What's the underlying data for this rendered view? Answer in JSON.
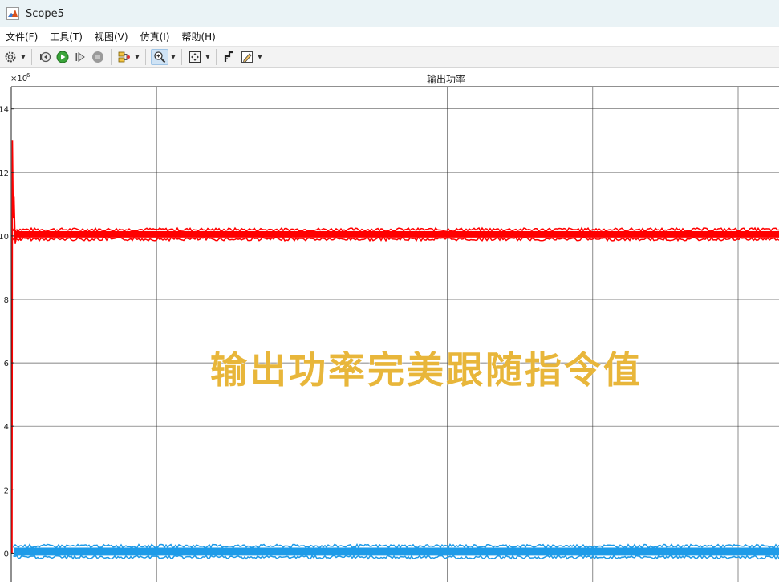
{
  "window": {
    "title": "Scope5"
  },
  "menu": [
    {
      "label": "文件(F)"
    },
    {
      "label": "工具(T)"
    },
    {
      "label": "视图(V)"
    },
    {
      "label": "仿真(I)"
    },
    {
      "label": "帮助(H)"
    }
  ],
  "toolbar": {
    "icons": [
      "settings-icon",
      "step-back-icon",
      "run-icon",
      "step-forward-icon",
      "stop-icon",
      "highlight-icon",
      "zoom-in-icon",
      "fit-to-view-icon",
      "cursor-measure-icon",
      "style-edit-icon"
    ]
  },
  "plot": {
    "title": "输出功率",
    "y_exponent_base": "×10",
    "y_exponent_power": "6",
    "y_tick_labels": [
      "14",
      "12",
      "10",
      "8",
      "6",
      "4",
      "2",
      "0"
    ],
    "overlay_caption": "输出功率完美跟随指令值"
  },
  "chart_data": {
    "type": "line",
    "title": "输出功率",
    "y_scale_factor": 1000000,
    "ylim": [
      -0.9,
      14.7
    ],
    "yticks": [
      0,
      2,
      4,
      6,
      8,
      10,
      12,
      14
    ],
    "grid": true,
    "series": [
      {
        "color": "#ff0000",
        "steady_value": 10.05,
        "noise_band": 0.2,
        "initial_spike_peak": 13.0
      },
      {
        "color": "#1e9be8",
        "steady_value": 0.05,
        "noise_band": 0.25
      }
    ]
  },
  "colors": {
    "red_series": "#ff0000",
    "blue_series": "#1e9be8",
    "caption": "#e8b63a",
    "grid": "#262626"
  }
}
